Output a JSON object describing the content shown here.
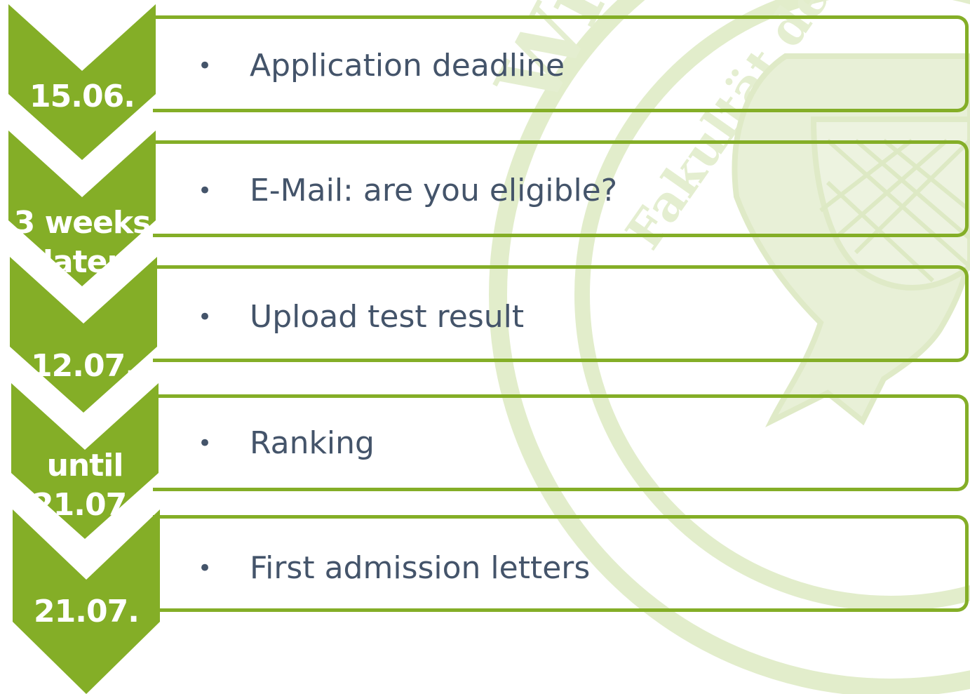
{
  "colors": {
    "accent": "#84ae27",
    "text": "#44546a",
    "watermark": "#e2edcb"
  },
  "steps": [
    {
      "date": "15.06.",
      "text": "Application deadline"
    },
    {
      "date": "3 weeks later",
      "date_lines": [
        "3 weeks",
        "later"
      ],
      "text": "E-Mail: are you eligible?"
    },
    {
      "date": "12.07.",
      "text": "Upload test result"
    },
    {
      "date": "until 21.07.",
      "date_lines": [
        "until",
        "21.07."
      ],
      "text": "Ranking"
    },
    {
      "date": "21.07.",
      "text": "First admission letters"
    }
  ],
  "bullet_symbol": "•",
  "watermark_text": "Wirtschafts- und Sozialwissenschaftliche Fakultät der Universität"
}
